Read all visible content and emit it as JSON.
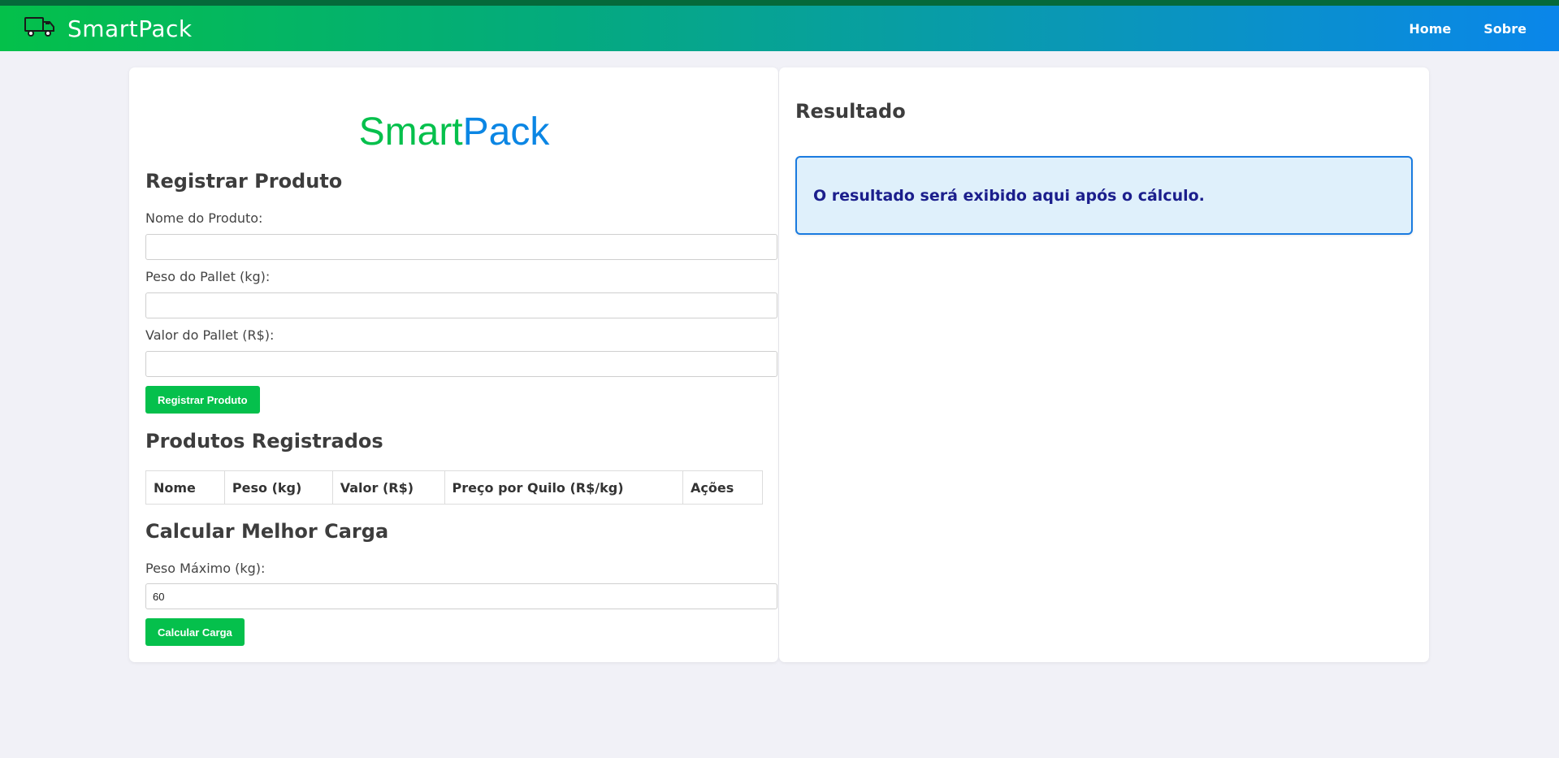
{
  "navbar": {
    "brand": "SmartPack",
    "brand_icon": "truck-icon",
    "links": [
      "Home",
      "Sobre"
    ],
    "gradient_colors": [
      "#04c04a",
      "#0a86ea"
    ]
  },
  "logo": {
    "smart": "Smart",
    "pack": "Pack",
    "colors": {
      "smart": "#05c04c",
      "pack": "#0b86e4"
    }
  },
  "register": {
    "title": "Registrar Produto",
    "name_label": "Nome do Produto:",
    "name_value": "",
    "weight_label": "Peso do Pallet (kg):",
    "weight_value": "",
    "value_label": "Valor do Pallet (R$):",
    "value_value": "",
    "submit_label": "Registrar Produto"
  },
  "products": {
    "title": "Produtos Registrados",
    "columns": [
      "Nome",
      "Peso (kg)",
      "Valor (R$)",
      "Preço por Quilo (R$/kg)",
      "Ações"
    ],
    "rows": []
  },
  "calculate": {
    "title": "Calcular Melhor Carga",
    "max_weight_label": "Peso Máximo (kg):",
    "max_weight_value": "60",
    "submit_label": "Calcular Carga"
  },
  "result": {
    "title": "Resultado",
    "placeholder": "O resultado será exibido aqui após o cálculo."
  }
}
